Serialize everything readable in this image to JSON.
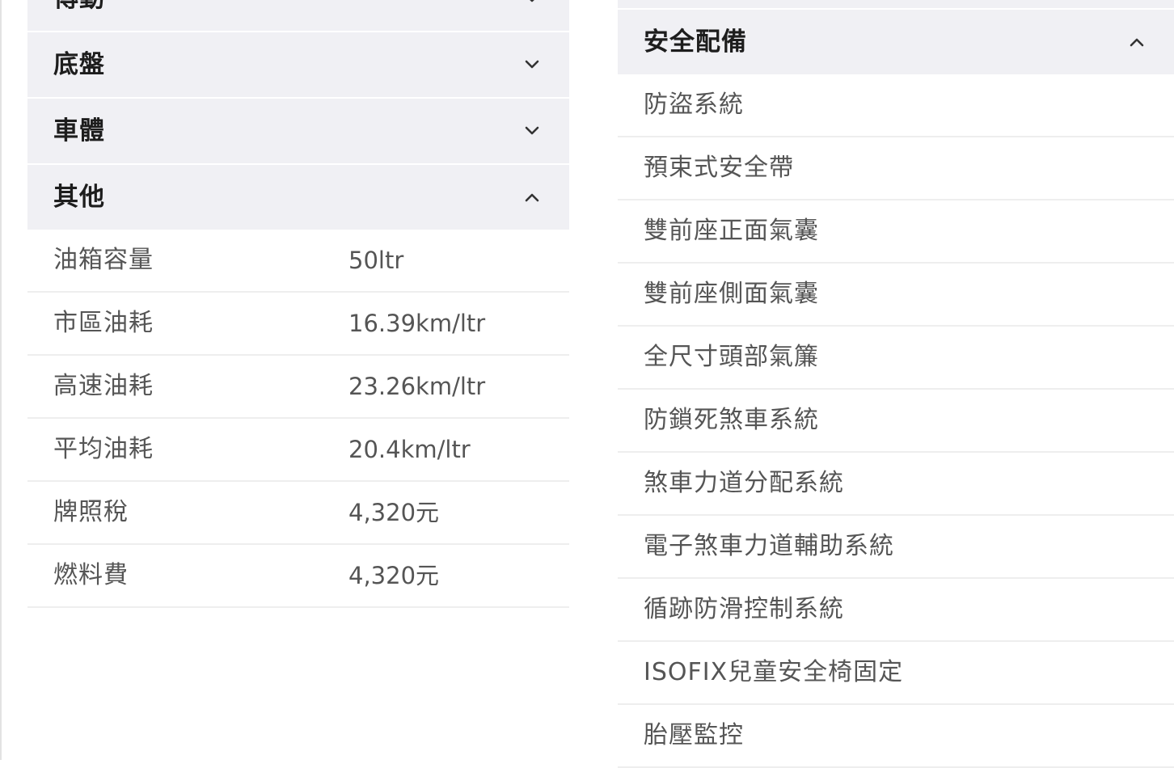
{
  "left_panel": {
    "sections": [
      {
        "title": "傳動",
        "expanded": false
      },
      {
        "title": "底盤",
        "expanded": false
      },
      {
        "title": "車體",
        "expanded": false
      },
      {
        "title": "其他",
        "expanded": true
      }
    ],
    "other_specs": [
      {
        "label": "油箱容量",
        "value": "50ltr"
      },
      {
        "label": "市區油耗",
        "value": "16.39km/ltr"
      },
      {
        "label": "高速油耗",
        "value": "23.26km/ltr"
      },
      {
        "label": "平均油耗",
        "value": "20.4km/ltr"
      },
      {
        "label": "牌照稅",
        "value": "4,320元"
      },
      {
        "label": "燃料費",
        "value": "4,320元"
      }
    ]
  },
  "right_panel": {
    "section": {
      "title": "安全配備",
      "expanded": true
    },
    "features": [
      "防盜系統",
      "預束式安全帶",
      "雙前座正面氣囊",
      "雙前座側面氣囊",
      "全尺寸頭部氣簾",
      "防鎖死煞車系統",
      "煞車力道分配系統",
      "電子煞車力道輔助系統",
      "循跡防滑控制系統",
      "ISOFIX兒童安全椅固定",
      "胎壓監控"
    ]
  },
  "icons": {
    "collapsed": "chevron-down-icon",
    "expanded": "chevron-up-icon"
  },
  "colors": {
    "header_bg": "#f0f0f4",
    "divider": "#eeeeee",
    "text_muted": "#555555"
  }
}
